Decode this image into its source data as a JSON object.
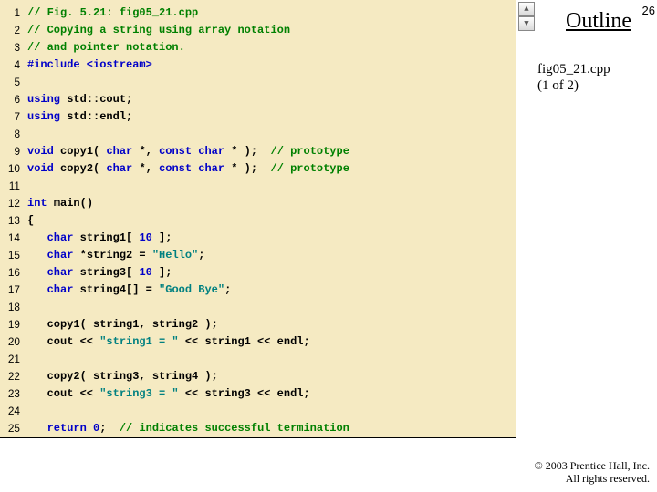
{
  "slide_number": "26",
  "outline": {
    "title": "Outline",
    "file": "fig05_21.cpp",
    "page": "(1 of 2)"
  },
  "scroll": {
    "up": "▲",
    "down": "▼"
  },
  "copyright": {
    "line1": "© 2003 Prentice Hall, Inc.",
    "line2": "All rights reserved."
  },
  "code": {
    "lines": [
      {
        "n": "1",
        "tokens": [
          {
            "t": "// Fig. 5.21: fig05_21.cpp",
            "c": "c"
          }
        ]
      },
      {
        "n": "2",
        "tokens": [
          {
            "t": "// Copying a string using array notation",
            "c": "c"
          }
        ]
      },
      {
        "n": "3",
        "tokens": [
          {
            "t": "// and pointer notation.",
            "c": "c"
          }
        ]
      },
      {
        "n": "4",
        "tokens": [
          {
            "t": "#include <iostream>",
            "c": "pp"
          }
        ]
      },
      {
        "n": "5",
        "tokens": []
      },
      {
        "n": "6",
        "tokens": [
          {
            "t": "using ",
            "c": "kw"
          },
          {
            "t": "std::cout;",
            "c": ""
          }
        ]
      },
      {
        "n": "7",
        "tokens": [
          {
            "t": "using ",
            "c": "kw"
          },
          {
            "t": "std::endl;",
            "c": ""
          }
        ]
      },
      {
        "n": "8",
        "tokens": []
      },
      {
        "n": "9",
        "tokens": [
          {
            "t": "void ",
            "c": "kw"
          },
          {
            "t": "copy1( ",
            "c": ""
          },
          {
            "t": "char ",
            "c": "kw"
          },
          {
            "t": "*, ",
            "c": ""
          },
          {
            "t": "const char ",
            "c": "kw"
          },
          {
            "t": "* );  ",
            "c": ""
          },
          {
            "t": "// prototype",
            "c": "c"
          }
        ]
      },
      {
        "n": "10",
        "tokens": [
          {
            "t": "void ",
            "c": "kw"
          },
          {
            "t": "copy2( ",
            "c": ""
          },
          {
            "t": "char ",
            "c": "kw"
          },
          {
            "t": "*, ",
            "c": ""
          },
          {
            "t": "const char ",
            "c": "kw"
          },
          {
            "t": "* );  ",
            "c": ""
          },
          {
            "t": "// prototype",
            "c": "c"
          }
        ]
      },
      {
        "n": "11",
        "tokens": []
      },
      {
        "n": "12",
        "tokens": [
          {
            "t": "int ",
            "c": "kw"
          },
          {
            "t": "main()",
            "c": ""
          }
        ]
      },
      {
        "n": "13",
        "tokens": [
          {
            "t": "{",
            "c": ""
          }
        ]
      },
      {
        "n": "14",
        "tokens": [
          {
            "t": "   ",
            "c": ""
          },
          {
            "t": "char ",
            "c": "kw"
          },
          {
            "t": "string1[ ",
            "c": ""
          },
          {
            "t": "10 ",
            "c": "kw"
          },
          {
            "t": "];",
            "c": ""
          }
        ]
      },
      {
        "n": "15",
        "tokens": [
          {
            "t": "   ",
            "c": ""
          },
          {
            "t": "char ",
            "c": "kw"
          },
          {
            "t": "*string2 = ",
            "c": ""
          },
          {
            "t": "\"Hello\"",
            "c": "st"
          },
          {
            "t": ";",
            "c": ""
          }
        ]
      },
      {
        "n": "16",
        "tokens": [
          {
            "t": "   ",
            "c": ""
          },
          {
            "t": "char ",
            "c": "kw"
          },
          {
            "t": "string3[ ",
            "c": ""
          },
          {
            "t": "10 ",
            "c": "kw"
          },
          {
            "t": "];",
            "c": ""
          }
        ]
      },
      {
        "n": "17",
        "tokens": [
          {
            "t": "   ",
            "c": ""
          },
          {
            "t": "char ",
            "c": "kw"
          },
          {
            "t": "string4[] = ",
            "c": ""
          },
          {
            "t": "\"Good Bye\"",
            "c": "st"
          },
          {
            "t": ";",
            "c": ""
          }
        ]
      },
      {
        "n": "18",
        "tokens": []
      },
      {
        "n": "19",
        "tokens": [
          {
            "t": "   copy1( string1, string2 );",
            "c": ""
          }
        ]
      },
      {
        "n": "20",
        "tokens": [
          {
            "t": "   cout << ",
            "c": ""
          },
          {
            "t": "\"string1 = \" ",
            "c": "st"
          },
          {
            "t": "<< string1 << endl;",
            "c": ""
          }
        ]
      },
      {
        "n": "21",
        "tokens": []
      },
      {
        "n": "22",
        "tokens": [
          {
            "t": "   copy2( string3, string4 );",
            "c": ""
          }
        ]
      },
      {
        "n": "23",
        "tokens": [
          {
            "t": "   cout << ",
            "c": ""
          },
          {
            "t": "\"string3 = \" ",
            "c": "st"
          },
          {
            "t": "<< string3 << endl;",
            "c": ""
          }
        ]
      },
      {
        "n": "24",
        "tokens": []
      },
      {
        "n": "25",
        "tokens": [
          {
            "t": "   ",
            "c": ""
          },
          {
            "t": "return ",
            "c": "kw"
          },
          {
            "t": "0",
            "c": "kw"
          },
          {
            "t": ";  ",
            "c": ""
          },
          {
            "t": "// indicates successful termination",
            "c": "c"
          }
        ]
      }
    ]
  }
}
